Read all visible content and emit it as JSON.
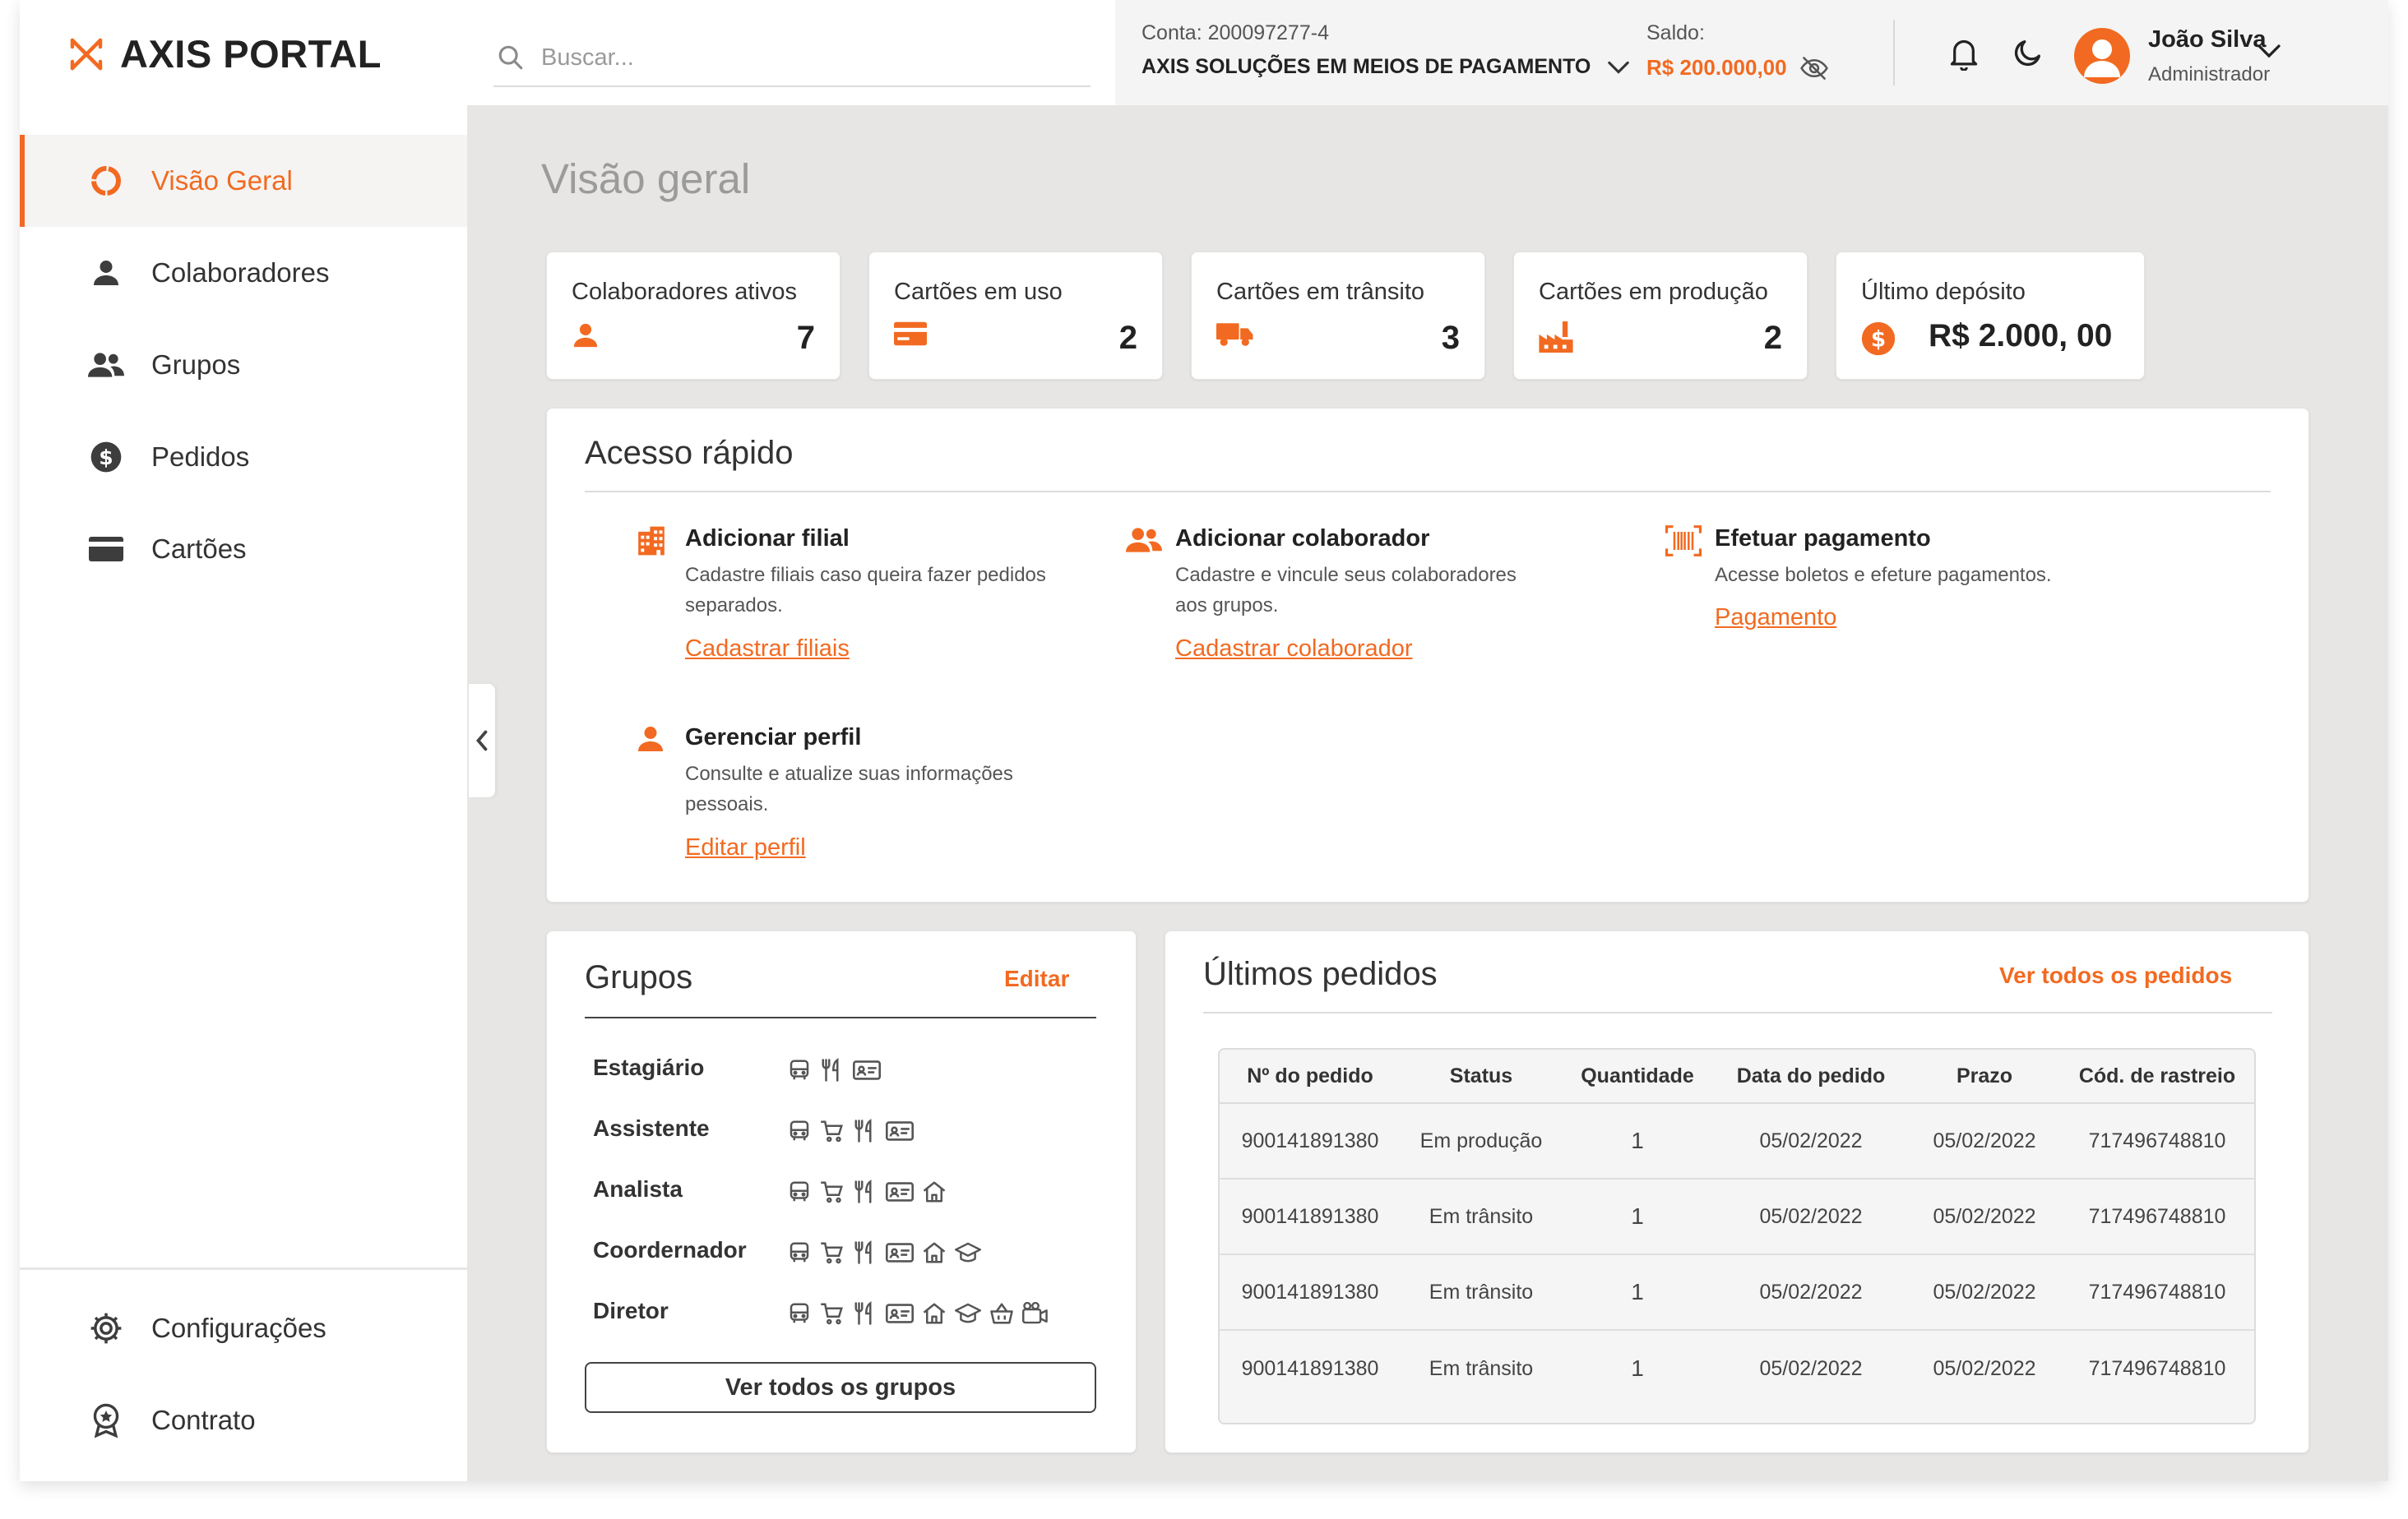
{
  "app": {
    "name": "AXIS PORTAL",
    "accent": "#f26a21"
  },
  "sidebar": {
    "items": [
      {
        "label": "Visão Geral",
        "icon": "overview-ring-icon",
        "active": true
      },
      {
        "label": "Colaboradores",
        "icon": "person-icon"
      },
      {
        "label": "Grupos",
        "icon": "people-icon"
      },
      {
        "label": "Pedidos",
        "icon": "dollar-circle-icon"
      },
      {
        "label": "Cartões",
        "icon": "card-icon"
      }
    ],
    "bottom_items": [
      {
        "label": "Configurações",
        "icon": "gear-icon"
      },
      {
        "label": "Contrato",
        "icon": "award-icon"
      }
    ]
  },
  "header": {
    "search_placeholder": "Buscar...",
    "account_label": "Conta: 200097277-4",
    "account_name": "AXIS SOLUÇÕES EM MEIOS DE PAGAMENTO",
    "balance_label": "Saldo:",
    "balance_value": "R$ 200.000,00",
    "user_name": "João Silva",
    "user_role": "Administrador"
  },
  "page": {
    "title": "Visão geral"
  },
  "stats": [
    {
      "label": "Colaboradores ativos",
      "value": "7",
      "icon": "person-icon"
    },
    {
      "label": "Cartões em uso",
      "value": "2",
      "icon": "card-icon"
    },
    {
      "label": "Cartões em trânsito",
      "value": "3",
      "icon": "truck-icon"
    },
    {
      "label": "Cartões em produção",
      "value": "2",
      "icon": "factory-icon"
    },
    {
      "label": "Último depósito",
      "value": "R$ 2.000, 00",
      "icon": "dollar-circle-icon"
    }
  ],
  "quick_access": {
    "title": "Acesso rápido",
    "items": [
      {
        "title": "Adicionar filial",
        "desc": "Cadastre filiais caso queira fazer pedidos separados.",
        "link": "Cadastrar filiais",
        "icon": "building-icon"
      },
      {
        "title": "Adicionar colaborador",
        "desc": "Cadastre e vincule seus colaboradores aos grupos.",
        "link": "Cadastrar colaborador",
        "icon": "people-icon"
      },
      {
        "title": "Efetuar pagamento",
        "desc": "Acesse boletos e efeture pagamentos.",
        "link": "Pagamento",
        "icon": "barcode-scan-icon"
      },
      {
        "title": "Gerenciar perfil",
        "desc": "Consulte e atualize suas informações pessoais.",
        "link": "Editar perfil",
        "icon": "person-icon"
      }
    ]
  },
  "groups": {
    "title": "Grupos",
    "edit_label": "Editar",
    "button_label": "Ver todos os grupos",
    "rows": [
      {
        "name": "Estagiário",
        "icons": [
          "bus",
          "food",
          "id-card"
        ]
      },
      {
        "name": "Assistente",
        "icons": [
          "bus",
          "cart",
          "food",
          "id-card"
        ]
      },
      {
        "name": "Analista",
        "icons": [
          "bus",
          "cart",
          "food",
          "id-card",
          "home"
        ]
      },
      {
        "name": "Coordernador",
        "icons": [
          "bus",
          "cart",
          "food",
          "id-card",
          "home",
          "grad-cap"
        ]
      },
      {
        "name": "Diretor",
        "icons": [
          "bus",
          "cart",
          "food",
          "id-card",
          "home",
          "grad-cap",
          "basket",
          "movie"
        ]
      }
    ]
  },
  "orders": {
    "title": "Últimos pedidos",
    "view_all": "Ver todos os pedidos",
    "columns": [
      "Nº do pedido",
      "Status",
      "Quantidade",
      "Data do pedido",
      "Prazo",
      "Cód. de rastreio"
    ],
    "rows": [
      [
        "900141891380",
        "Em produção",
        "1",
        "05/02/2022",
        "05/02/2022",
        "717496748810"
      ],
      [
        "900141891380",
        "Em trânsito",
        "1",
        "05/02/2022",
        "05/02/2022",
        "717496748810"
      ],
      [
        "900141891380",
        "Em trânsito",
        "1",
        "05/02/2022",
        "05/02/2022",
        "717496748810"
      ],
      [
        "900141891380",
        "Em trânsito",
        "1",
        "05/02/2022",
        "05/02/2022",
        "717496748810"
      ]
    ]
  }
}
